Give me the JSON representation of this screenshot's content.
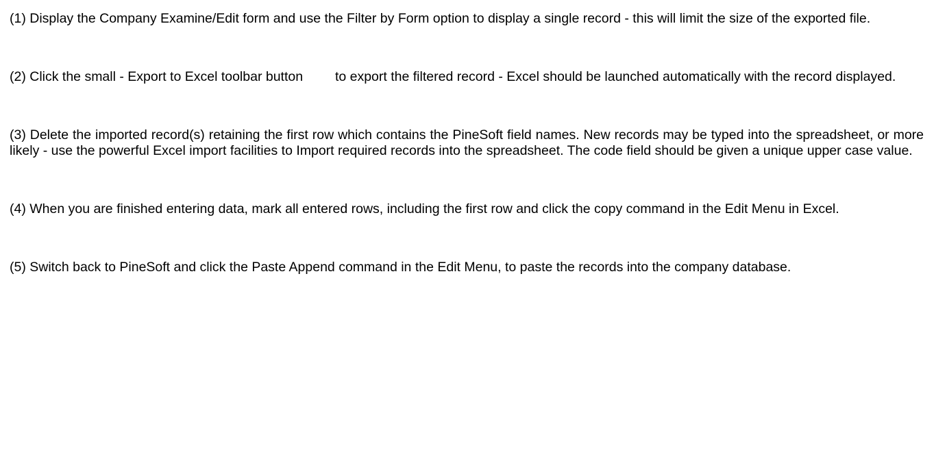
{
  "steps": [
    {
      "text": "(1) Display the Company Examine/Edit form and use the Filter by Form option to display a single record - this will limit the size of the exported file."
    },
    {
      "text_before": "(2) Click the small - Export to Excel toolbar button",
      "text_after": "to export the filtered record - Excel should be launched automatically with the record displayed.",
      "icon": "export-to-excel-icon"
    },
    {
      "text": "(3) Delete the imported record(s) retaining the first row which contains the PineSoft field names. New records may be typed into the spreadsheet, or more likely - use the powerful Excel import facilities to Import required records into the spreadsheet. The code field should be given a unique upper case value."
    },
    {
      "text": "(4) When you are finished entering data, mark all entered rows, including the first row and click the copy command in the Edit Menu in Excel."
    },
    {
      "text": "(5) Switch back to PineSoft and click the Paste Append command in the Edit Menu, to paste the records into the company database."
    }
  ]
}
